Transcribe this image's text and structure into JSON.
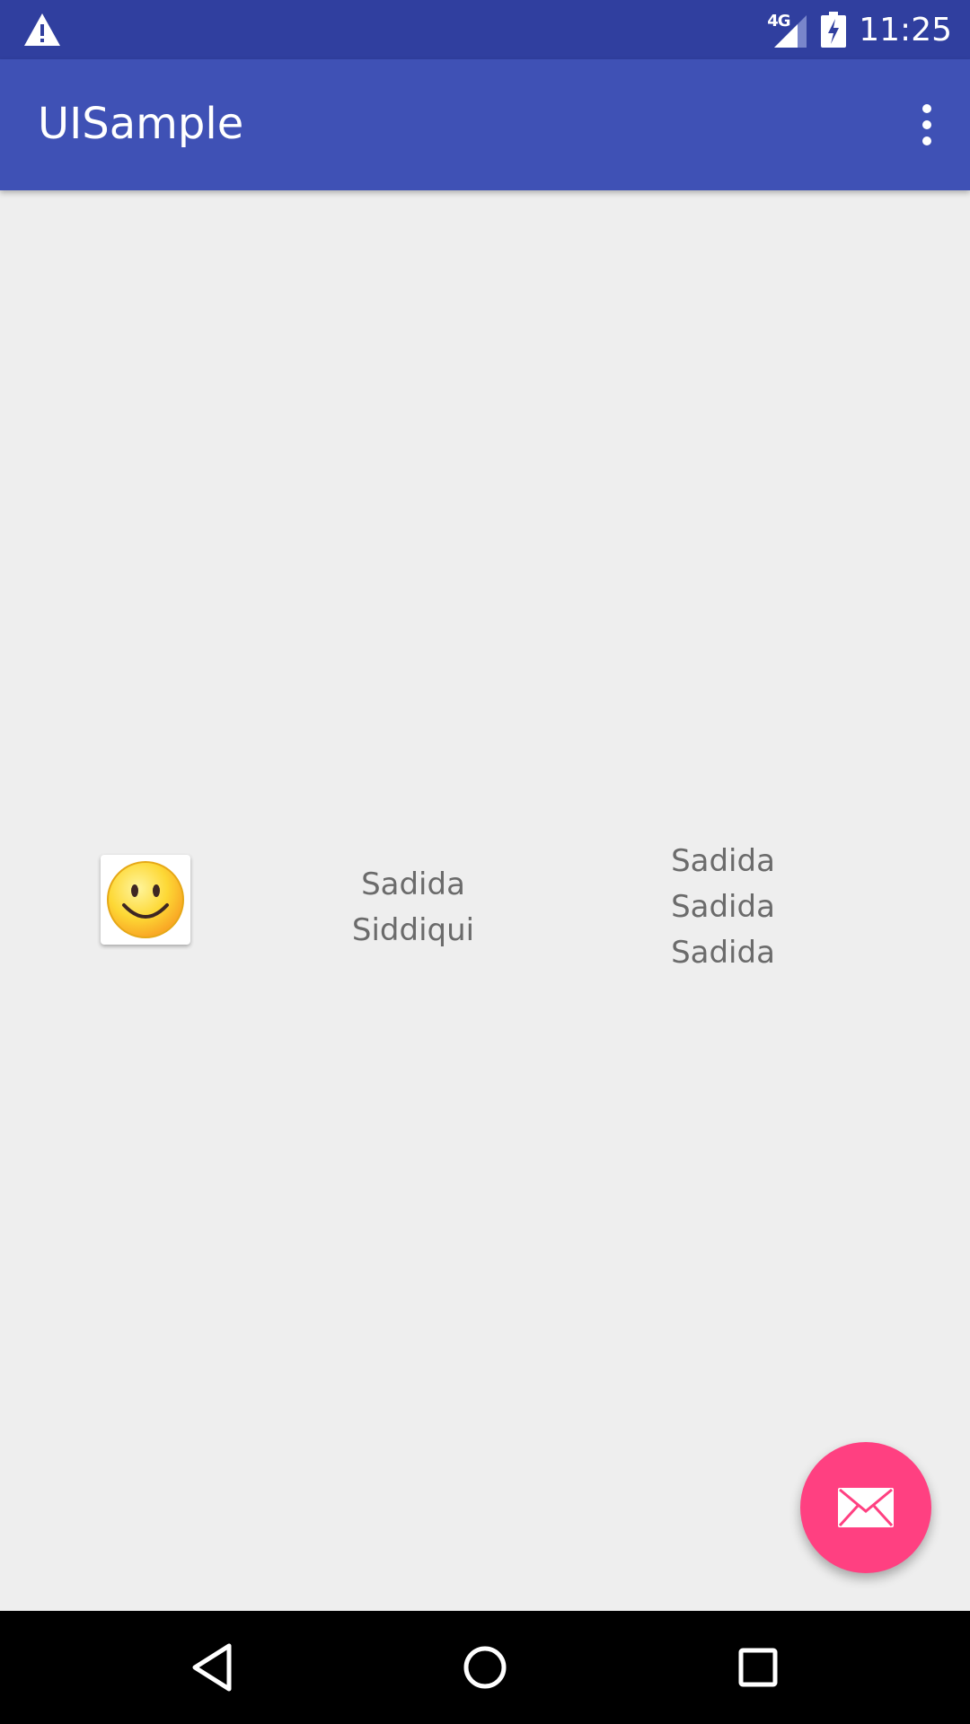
{
  "status_bar": {
    "time": "11:25",
    "network": "4G",
    "icons": [
      "warning-icon",
      "signal-icon",
      "battery-charging-icon"
    ]
  },
  "app_bar": {
    "title": "UISample",
    "overflow_icon": "more-vert-icon"
  },
  "content": {
    "image_icon": "smiley-face-icon",
    "name_lines": [
      "Sadida",
      "Siddiqui"
    ],
    "repeat_lines": [
      "Sadida",
      "Sadida",
      "Sadida"
    ]
  },
  "fab": {
    "icon": "email-icon"
  },
  "nav_bar": {
    "buttons": [
      "back-icon",
      "home-icon",
      "recents-icon"
    ]
  },
  "colors": {
    "status_bar": "#303f9f",
    "app_bar": "#3f51b5",
    "background": "#eeeeee",
    "fab": "#ff4081",
    "text": "#6b6b6b"
  }
}
